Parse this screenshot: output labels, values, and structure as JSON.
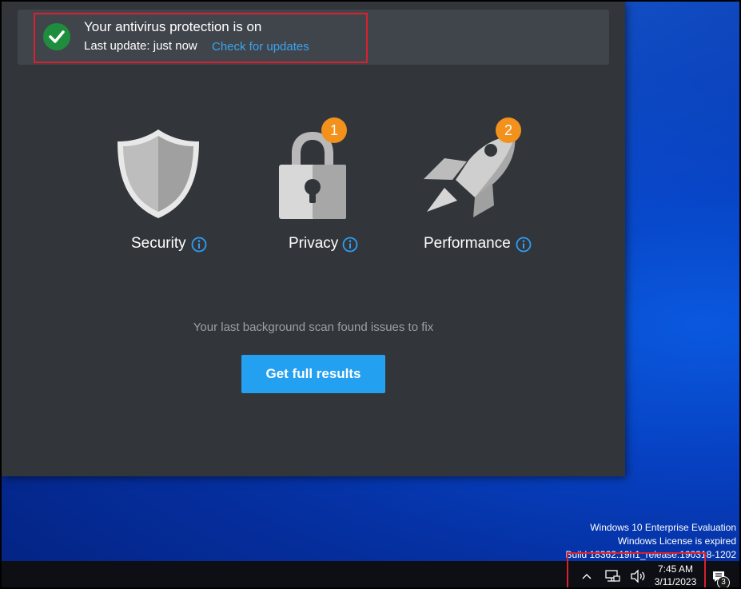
{
  "antivirus": {
    "status_title": "Your antivirus protection is on",
    "last_update": "Last update: just now",
    "check_updates_link": "Check for updates",
    "features": [
      {
        "label": "Security",
        "icon": "shield-icon",
        "badge": ""
      },
      {
        "label": "Privacy",
        "icon": "padlock-icon",
        "badge": "1"
      },
      {
        "label": "Performance",
        "icon": "rocket-icon",
        "badge": "2"
      }
    ],
    "scan_message": "Your last background scan found issues to fix",
    "results_button": "Get full results",
    "colors": {
      "accent": "#24a0f0",
      "badge": "#f2911b",
      "success": "#1e8e3e",
      "window_bg": "#32363b",
      "highlight": "#d9202f"
    }
  },
  "desktop": {
    "watermark": {
      "line1": "Windows 10 Enterprise Evaluation",
      "line2": "Windows License is expired",
      "line3": "Build 18362.19h1_release.190318-1202"
    }
  },
  "taskbar": {
    "tray_icons": [
      "chevron-up-icon",
      "network-icon",
      "volume-icon"
    ],
    "time": "7:45 AM",
    "date": "3/11/2023",
    "notification_count": "3"
  }
}
